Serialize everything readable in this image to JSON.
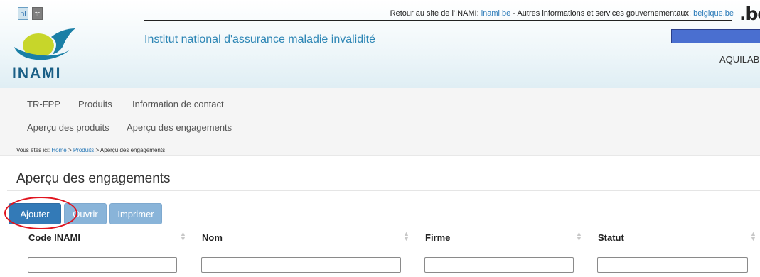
{
  "languages": {
    "nl": "nl",
    "fr": "fr"
  },
  "top_bar": {
    "text1": "Retour au site de l'INAMI:",
    "link1": "inami.be",
    "text2": "- Autres informations et services gouvernementaux:",
    "link2": "belgique.be",
    "be_logo": ".be"
  },
  "logo": {
    "text": "INAMI"
  },
  "institute_name": "Institut national d'assurance maladie invalidité",
  "user": {
    "name": "AQUILAB"
  },
  "nav": {
    "primary": [
      "TR-FPP",
      "Produits",
      "Information de contact"
    ],
    "secondary": [
      "Aperçu des produits",
      "Aperçu des engagements"
    ]
  },
  "breadcrumb": {
    "prefix": "Vous êtes ici:",
    "home": "Home",
    "sep1": ">",
    "products": "Produits",
    "sep2": ">",
    "current": "Aperçu des engagements"
  },
  "page_title": "Aperçu des engagements",
  "buttons": {
    "add": "Ajouter",
    "open": "Ouvrir",
    "print": "Imprimer"
  },
  "table": {
    "columns": [
      "Code INAMI",
      "Nom",
      "Firme",
      "Statut"
    ],
    "sort_icon": "sort-both-icon"
  },
  "colors": {
    "primary_button": "#337ab7",
    "disabled_button": "#89b4d9",
    "link": "#2a7ab8",
    "highlight": "#e0141e"
  }
}
